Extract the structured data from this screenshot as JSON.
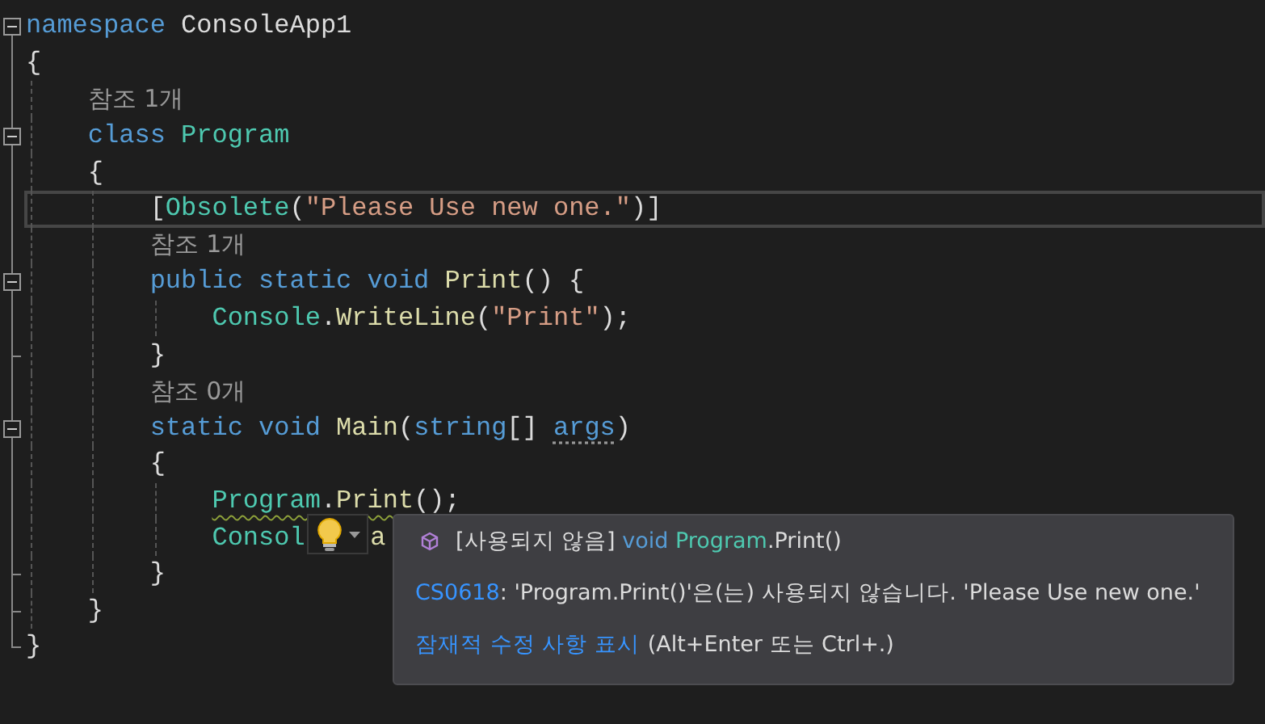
{
  "editor": {
    "lines": [
      {
        "kind": "code",
        "fold_start": true,
        "tokens": [
          {
            "text": "namespace",
            "kind": "keyword"
          },
          {
            "text": " ConsoleApp1",
            "kind": "plain"
          }
        ]
      },
      {
        "kind": "code",
        "tokens": [
          {
            "text": "{",
            "kind": "plain"
          }
        ]
      },
      {
        "kind": "lens",
        "tokens": [
          {
            "text": "    참조 1개",
            "kind": "lens"
          }
        ]
      },
      {
        "kind": "code",
        "fold_start": true,
        "tokens": [
          {
            "text": "    class",
            "kind": "keyword"
          },
          {
            "text": " Program",
            "kind": "type"
          }
        ]
      },
      {
        "kind": "code",
        "tokens": [
          {
            "text": "    {",
            "kind": "plain"
          }
        ]
      },
      {
        "kind": "code",
        "current": true,
        "tokens": [
          {
            "text": "        [",
            "kind": "plain"
          },
          {
            "text": "Obsolete",
            "kind": "type"
          },
          {
            "text": "(",
            "kind": "plain"
          },
          {
            "text": "\"Please Use new one.\"",
            "kind": "string"
          },
          {
            "text": ")]",
            "kind": "plain"
          }
        ]
      },
      {
        "kind": "lens",
        "tokens": [
          {
            "text": "        참조 1개",
            "kind": "lens"
          }
        ]
      },
      {
        "kind": "code",
        "fold_start": true,
        "tokens": [
          {
            "text": "        public static void",
            "kind": "keyword"
          },
          {
            "text": " Print",
            "kind": "method"
          },
          {
            "text": "() {",
            "kind": "plain"
          }
        ]
      },
      {
        "kind": "code",
        "tokens": [
          {
            "text": "            Console",
            "kind": "type"
          },
          {
            "text": ".",
            "kind": "plain"
          },
          {
            "text": "WriteLine",
            "kind": "method"
          },
          {
            "text": "(",
            "kind": "plain"
          },
          {
            "text": "\"Print\"",
            "kind": "string"
          },
          {
            "text": ");",
            "kind": "plain"
          }
        ]
      },
      {
        "kind": "code",
        "fold_end": true,
        "tokens": [
          {
            "text": "        }",
            "kind": "plain"
          }
        ]
      },
      {
        "kind": "lens",
        "tokens": [
          {
            "text": "        참조 0개",
            "kind": "lens"
          }
        ]
      },
      {
        "kind": "code",
        "fold_start": true,
        "tokens": [
          {
            "text": "        static void",
            "kind": "keyword"
          },
          {
            "text": " Main",
            "kind": "method"
          },
          {
            "text": "(",
            "kind": "plain"
          },
          {
            "text": "string",
            "kind": "keyword"
          },
          {
            "text": "[] ",
            "kind": "plain"
          },
          {
            "text": "args",
            "kind": "keyword",
            "hint": true
          },
          {
            "text": ")",
            "kind": "plain"
          }
        ]
      },
      {
        "kind": "code",
        "tokens": [
          {
            "text": "        {",
            "kind": "plain"
          }
        ]
      },
      {
        "kind": "code",
        "tokens": [
          {
            "kind": "group",
            "squiggle": true,
            "tokens": [
              {
                "text": "            Program",
                "kind": "type"
              },
              {
                "text": ".",
                "kind": "plain"
              },
              {
                "text": "Print",
                "kind": "method"
              },
              {
                "text": "()",
                "kind": "plain"
              }
            ]
          },
          {
            "text": ";",
            "kind": "plain"
          }
        ]
      },
      {
        "kind": "code",
        "tokens": [
          {
            "text": "            Consol",
            "kind": "type"
          },
          {
            "text": "a",
            "kind": "method",
            "covered_before": true
          }
        ]
      },
      {
        "kind": "code",
        "fold_end": true,
        "tokens": [
          {
            "text": "        }",
            "kind": "plain"
          }
        ]
      },
      {
        "kind": "code",
        "fold_end": true,
        "tokens": [
          {
            "text": "    }",
            "kind": "plain"
          }
        ]
      },
      {
        "kind": "code",
        "fold_end": true,
        "tokens": [
          {
            "text": "}",
            "kind": "plain"
          }
        ]
      }
    ]
  },
  "quick_info": {
    "signature": [
      {
        "text": "[사용되지 않음] ",
        "kind": "plain"
      },
      {
        "text": "void ",
        "kind": "keyword"
      },
      {
        "text": "Program",
        "kind": "type"
      },
      {
        "text": ".Print()",
        "kind": "plain"
      }
    ],
    "error_code": "CS0618",
    "error_message": ": 'Program.Print()'은(는) 사용되지 않습니다. 'Please Use new one.'",
    "action_link": "잠재적 수정 사항 표시",
    "action_shortcut": "(Alt+Enter 또는 Ctrl+.)"
  }
}
